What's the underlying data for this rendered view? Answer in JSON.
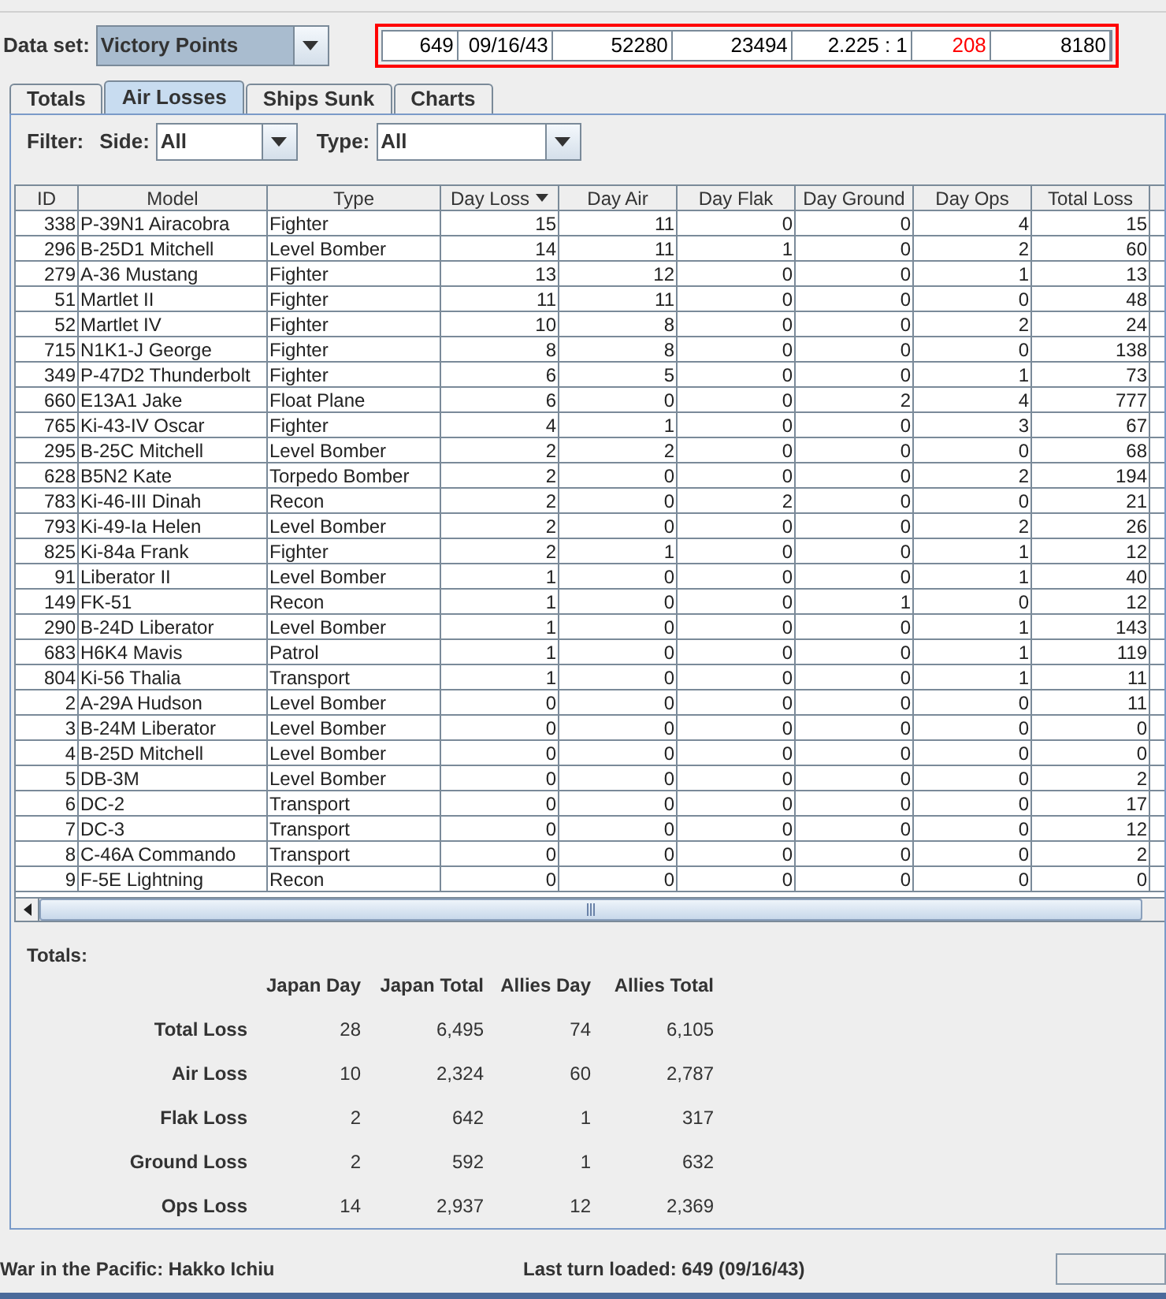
{
  "data_set": {
    "label": "Data set:",
    "value": "Victory Points"
  },
  "summary": [
    {
      "text": "649",
      "color": "#000000"
    },
    {
      "text": "09/16/43",
      "color": "#000000"
    },
    {
      "text": "52280",
      "color": "#000000"
    },
    {
      "text": "23494",
      "color": "#000000"
    },
    {
      "text": "2.225 : 1",
      "color": "#000000"
    },
    {
      "text": "208",
      "color": "#ff0000"
    },
    {
      "text": "8180",
      "color": "#000000"
    }
  ],
  "tabs": [
    {
      "label": "Totals",
      "selected": false
    },
    {
      "label": "Air Losses",
      "selected": true
    },
    {
      "label": "Ships Sunk",
      "selected": false
    },
    {
      "label": "Charts",
      "selected": false
    }
  ],
  "filter": {
    "label": "Filter:",
    "side_label": "Side:",
    "side": "All",
    "type_label": "Type:",
    "type": "All"
  },
  "table": {
    "columns": [
      {
        "label": "ID",
        "sorted": false
      },
      {
        "label": "Model",
        "sorted": false
      },
      {
        "label": "Type",
        "sorted": false
      },
      {
        "label": "Day Loss",
        "sorted": true
      },
      {
        "label": "Day Air",
        "sorted": false
      },
      {
        "label": "Day Flak",
        "sorted": false
      },
      {
        "label": "Day Ground",
        "sorted": false
      },
      {
        "label": "Day Ops",
        "sorted": false
      },
      {
        "label": "Total Loss",
        "sorted": false
      }
    ],
    "rows": [
      [
        "338",
        "P-39N1 Airacobra",
        "Fighter",
        "15",
        "11",
        "0",
        "0",
        "4",
        "15"
      ],
      [
        "296",
        "B-25D1 Mitchell",
        "Level Bomber",
        "14",
        "11",
        "1",
        "0",
        "2",
        "60"
      ],
      [
        "279",
        "A-36 Mustang",
        "Fighter",
        "13",
        "12",
        "0",
        "0",
        "1",
        "13"
      ],
      [
        "51",
        "Martlet II",
        "Fighter",
        "11",
        "11",
        "0",
        "0",
        "0",
        "48"
      ],
      [
        "52",
        "Martlet IV",
        "Fighter",
        "10",
        "8",
        "0",
        "0",
        "2",
        "24"
      ],
      [
        "715",
        "N1K1-J George",
        "Fighter",
        "8",
        "8",
        "0",
        "0",
        "0",
        "138"
      ],
      [
        "349",
        "P-47D2 Thunderbolt",
        "Fighter",
        "6",
        "5",
        "0",
        "0",
        "1",
        "73"
      ],
      [
        "660",
        "E13A1 Jake",
        "Float Plane",
        "6",
        "0",
        "0",
        "2",
        "4",
        "777"
      ],
      [
        "765",
        "Ki-43-IV Oscar",
        "Fighter",
        "4",
        "1",
        "0",
        "0",
        "3",
        "67"
      ],
      [
        "295",
        "B-25C Mitchell",
        "Level Bomber",
        "2",
        "2",
        "0",
        "0",
        "0",
        "68"
      ],
      [
        "628",
        "B5N2 Kate",
        "Torpedo Bomber",
        "2",
        "0",
        "0",
        "0",
        "2",
        "194"
      ],
      [
        "783",
        "Ki-46-III Dinah",
        "Recon",
        "2",
        "0",
        "2",
        "0",
        "0",
        "21"
      ],
      [
        "793",
        "Ki-49-Ia Helen",
        "Level Bomber",
        "2",
        "0",
        "0",
        "0",
        "2",
        "26"
      ],
      [
        "825",
        "Ki-84a Frank",
        "Fighter",
        "2",
        "1",
        "0",
        "0",
        "1",
        "12"
      ],
      [
        "91",
        "Liberator II",
        "Level Bomber",
        "1",
        "0",
        "0",
        "0",
        "1",
        "40"
      ],
      [
        "149",
        "FK-51",
        "Recon",
        "1",
        "0",
        "0",
        "1",
        "0",
        "12"
      ],
      [
        "290",
        "B-24D Liberator",
        "Level Bomber",
        "1",
        "0",
        "0",
        "0",
        "1",
        "143"
      ],
      [
        "683",
        "H6K4 Mavis",
        "Patrol",
        "1",
        "0",
        "0",
        "0",
        "1",
        "119"
      ],
      [
        "804",
        "Ki-56 Thalia",
        "Transport",
        "1",
        "0",
        "0",
        "0",
        "1",
        "11"
      ],
      [
        "2",
        "A-29A Hudson",
        "Level Bomber",
        "0",
        "0",
        "0",
        "0",
        "0",
        "11"
      ],
      [
        "3",
        "B-24M Liberator",
        "Level Bomber",
        "0",
        "0",
        "0",
        "0",
        "0",
        "0"
      ],
      [
        "4",
        "B-25D Mitchell",
        "Level Bomber",
        "0",
        "0",
        "0",
        "0",
        "0",
        "0"
      ],
      [
        "5",
        "DB-3M",
        "Level Bomber",
        "0",
        "0",
        "0",
        "0",
        "0",
        "2"
      ],
      [
        "6",
        "DC-2",
        "Transport",
        "0",
        "0",
        "0",
        "0",
        "0",
        "17"
      ],
      [
        "7",
        "DC-3",
        "Transport",
        "0",
        "0",
        "0",
        "0",
        "0",
        "12"
      ],
      [
        "8",
        "C-46A Commando",
        "Transport",
        "0",
        "0",
        "0",
        "0",
        "0",
        "2"
      ],
      [
        "9",
        "F-5E Lightning",
        "Recon",
        "0",
        "0",
        "0",
        "0",
        "0",
        "0"
      ]
    ]
  },
  "totals": {
    "title": "Totals:",
    "columns": [
      "Japan Day",
      "Japan Total",
      "Allies Day",
      "Allies Total"
    ],
    "rows": [
      {
        "label": "Total Loss",
        "values": [
          "28",
          "6,495",
          "74",
          "6,105"
        ]
      },
      {
        "label": "Air Loss",
        "values": [
          "10",
          "2,324",
          "60",
          "2,787"
        ]
      },
      {
        "label": "Flak Loss",
        "values": [
          "2",
          "642",
          "1",
          "317"
        ]
      },
      {
        "label": "Ground Loss",
        "values": [
          "2",
          "592",
          "1",
          "632"
        ]
      },
      {
        "label": "Ops Loss",
        "values": [
          "14",
          "2,937",
          "12",
          "2,369"
        ]
      }
    ]
  },
  "status_bar": {
    "title": "War in the Pacific: Hakko Ichiu",
    "last_turn": "Last turn loaded: 649 (09/16/43)"
  }
}
